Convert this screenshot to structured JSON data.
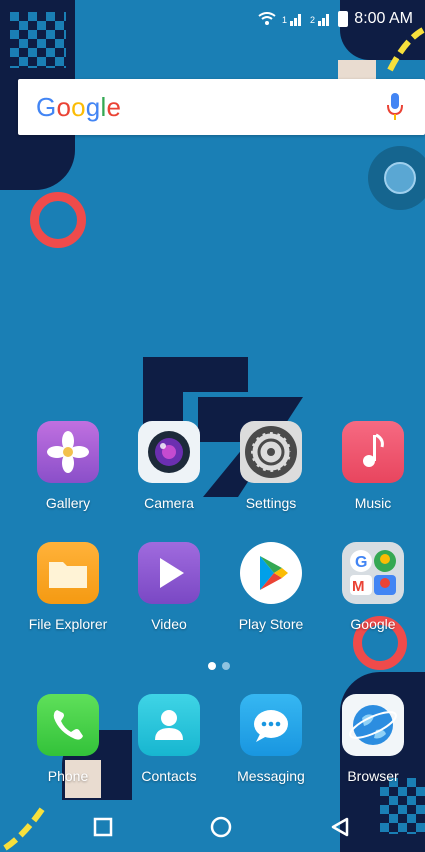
{
  "status_bar": {
    "time": "8:00 AM"
  },
  "search": {
    "logo_text": [
      "G",
      "o",
      "o",
      "g",
      "l",
      "e"
    ],
    "logo_colors": [
      "#4285f4",
      "#ea4335",
      "#fbbc05",
      "#4285f4",
      "#34a853",
      "#ea4335"
    ]
  },
  "apps_row1": [
    {
      "label": "Gallery",
      "icon": "gallery-flower-icon"
    },
    {
      "label": "Camera",
      "icon": "camera-lens-icon"
    },
    {
      "label": "Settings",
      "icon": "settings-gear-icon"
    },
    {
      "label": "Music",
      "icon": "music-note-icon"
    }
  ],
  "apps_row2": [
    {
      "label": "File Explorer",
      "icon": "folder-icon"
    },
    {
      "label": "Video",
      "icon": "play-icon"
    },
    {
      "label": "Play Store",
      "icon": "play-store-icon"
    },
    {
      "label": "Google",
      "icon": "google-apps-folder-icon"
    }
  ],
  "dock": [
    {
      "label": "Phone",
      "icon": "phone-icon"
    },
    {
      "label": "Contacts",
      "icon": "contacts-icon"
    },
    {
      "label": "Messaging",
      "icon": "chat-bubble-icon"
    },
    {
      "label": "Browser",
      "icon": "globe-icon"
    }
  ],
  "navigation": {
    "recent": "square-icon",
    "home": "circle-icon",
    "back": "triangle-back-icon"
  },
  "page_indicator": {
    "current": 1,
    "total": 2
  },
  "colors": {
    "wallpaper": "#1a7fb5",
    "accent_navy": "#0e1d44",
    "accent_red": "#ef4b4b",
    "accent_yellow": "#f7e03c"
  }
}
